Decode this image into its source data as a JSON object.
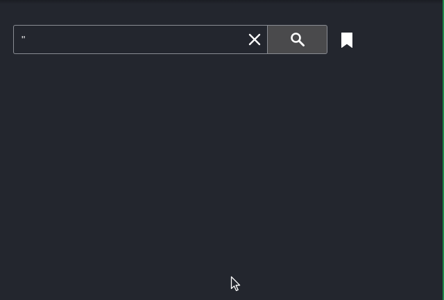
{
  "search": {
    "value": "\"",
    "placeholder": "",
    "clear_icon": "close-icon",
    "submit_icon": "search-icon"
  },
  "bookmark": {
    "icon": "bookmark-icon"
  },
  "colors": {
    "background": "#23262e",
    "input_border": "#8a8d94",
    "search_button_bg": "#4a4a4c",
    "icon_color": "#ffffff",
    "right_edge_accent": "#1f8a4a"
  }
}
